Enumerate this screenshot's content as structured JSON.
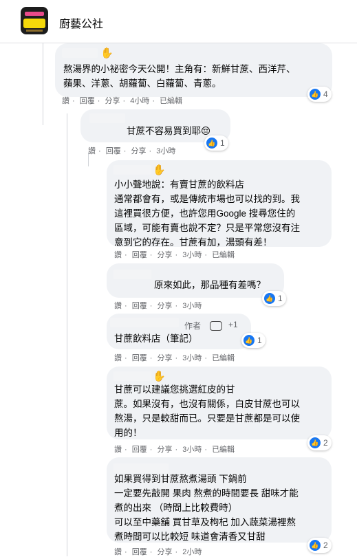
{
  "header": {
    "group_name": "廚藝公社"
  },
  "comments": [
    {
      "text": "熬湯界的小祕密今天公開！主角有：新鮮甘蔗、西洋芹、\n蘋果、洋蔥、胡蘿蔔、白蘿蔔、青蔥。",
      "reactions": "4",
      "actions": [
        "讚",
        "回覆",
        "分享",
        "4小時",
        "已編輯"
      ]
    },
    {
      "text": "甘蔗不容易買到耶😔",
      "reactions": "1",
      "actions": [
        "讚",
        "回覆",
        "分享",
        "3小時"
      ]
    },
    {
      "text": "小小聲地說：有賣甘蔗的飲料店\n通常都會有，或是傳統市場也可以找的到。我\n這裡買很方便，也許您用Google 搜尋您住的\n區域，可能有賣也說不定？只是平常您沒有注\n意到它的存在。甘蔗有加，湯頭有差！",
      "actions": [
        "讚",
        "回覆",
        "分享",
        "3小時",
        "已編輯"
      ]
    },
    {
      "text": "原來如此，那品種有差嗎？",
      "reactions": "1",
      "actions": [
        "讚",
        "回覆",
        "分享",
        "3小時"
      ]
    },
    {
      "badge": "作者",
      "plus": "+1",
      "text": "甘蔗飲料店（筆記）",
      "reactions": "1",
      "actions": [
        "讚",
        "回覆",
        "分享",
        "3小時",
        "已編輯"
      ]
    },
    {
      "text": "甘蔗可以建議您挑選紅皮的甘\n蔗。如果沒有，也沒有關係，白皮甘蔗也可以\n熬湯，只是較甜而已。只要是甘蔗都是可以使\n用的！",
      "reactions": "2",
      "actions": [
        "讚",
        "回覆",
        "分享",
        "3小時",
        "已編輯"
      ]
    },
    {
      "text": "如果買得到甘蔗熬煮湯頭 下鍋前\n一定要先敲開 果肉 熬煮的時間要長 甜味才能\n煮的出來 （時間上比較費時）\n可以至中藥舖 買甘草及枸杞 加入蔬菜湯裡熬\n煮時間可以比較短 味道會清香又甘甜",
      "reactions": "2",
      "actions": [
        "讚",
        "回覆",
        "分享",
        "2小時"
      ]
    }
  ]
}
